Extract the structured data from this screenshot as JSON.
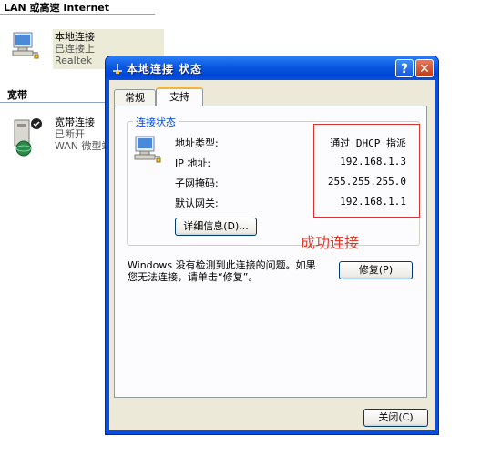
{
  "background": {
    "lan_heading": "LAN 或高速 Internet",
    "lan_item": {
      "name": "本地连接",
      "status": "已连接上",
      "device": "Realtek"
    },
    "broadband_heading": "宽带",
    "broadband_item": {
      "name": "宽带连接",
      "status": "已断开",
      "device": "WAN 微型端"
    }
  },
  "dialog": {
    "title": "本地连接  状态",
    "help_glyph": "?",
    "close_glyph": "✕",
    "tabs": [
      {
        "label": "常规",
        "active": false
      },
      {
        "label": "支持",
        "active": true
      }
    ],
    "group_title": "连接状态",
    "fields": [
      {
        "label": "地址类型:",
        "value": "通过 DHCP 指派"
      },
      {
        "label": "IP 地址:",
        "value": "192.168.1.3"
      },
      {
        "label": "子网掩码:",
        "value": "255.255.255.0"
      },
      {
        "label": "默认网关:",
        "value": "192.168.1.1"
      }
    ],
    "details_button": "详细信息(D)...",
    "message": "Windows 没有检测到此连接的问题。如果您无法连接，请单击“修复”。",
    "message_line1": "Windows 没有检测到此连接的问题。如果",
    "message_line2": "您无法连接，请单击“修复”。",
    "repair_button": "修复(P)",
    "close_button": "关闭(C)"
  },
  "annotation": "成功连接",
  "colors": {
    "title_bar": "#0a52e0",
    "highlight_box": "#d9332d",
    "annotation": "#e03a2a",
    "group_title": "#0046d5"
  }
}
